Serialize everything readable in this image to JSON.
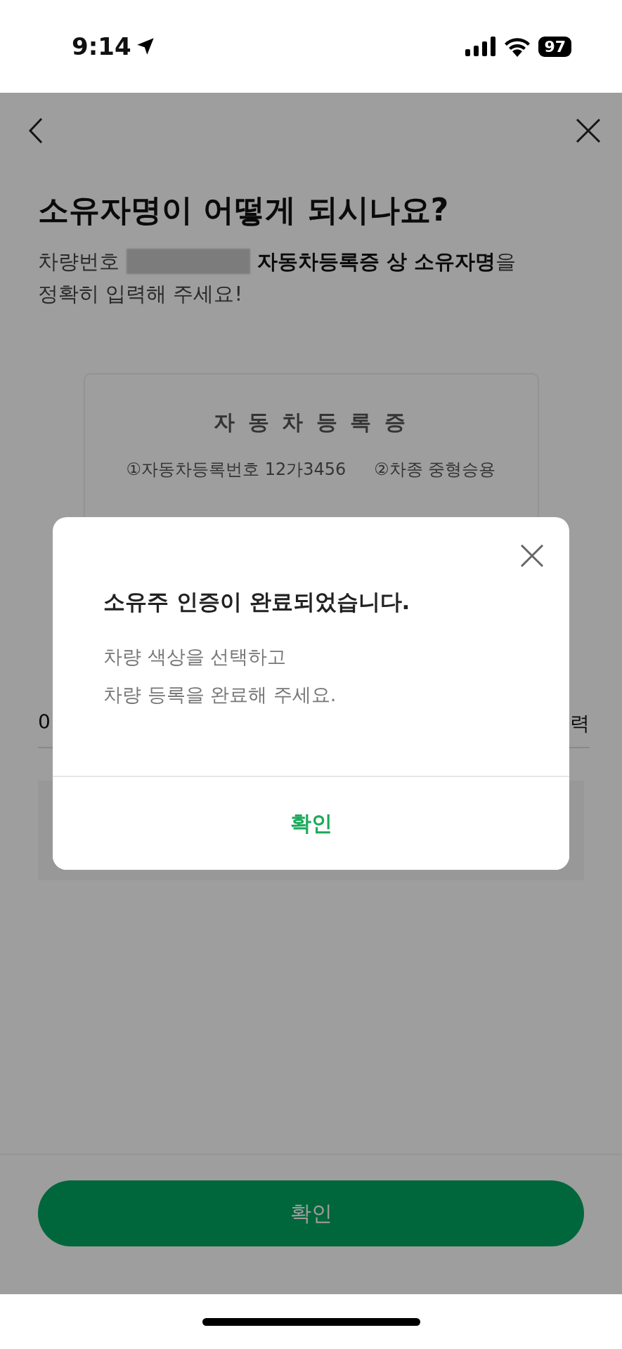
{
  "status_bar": {
    "time": "9:14",
    "battery": "97"
  },
  "title": "소유자명이 어떻게 되시나요?",
  "subtitle": {
    "lead": "차량번호",
    "rest": "**자동차등록증 상 소유자명**을",
    "line2": "정확히 입력해 주세요!"
  },
  "registration_card": {
    "heading": "자 동 차 등 록 증",
    "fields": [
      {
        "marker": "①",
        "label": "자동차등록번호",
        "value": "12가3456"
      },
      {
        "marker": "②",
        "label": "차종",
        "value": "중형승용"
      }
    ]
  },
  "name_field": {
    "prefix": "0",
    "suffix": "력"
  },
  "dialog": {
    "title": "소유주 인증이 완료되었습니다.",
    "message": [
      "차량 색상을 선택하고",
      "차량 등록을 완료해 주세요."
    ],
    "confirm": "확인"
  },
  "bottom_button": "확인"
}
